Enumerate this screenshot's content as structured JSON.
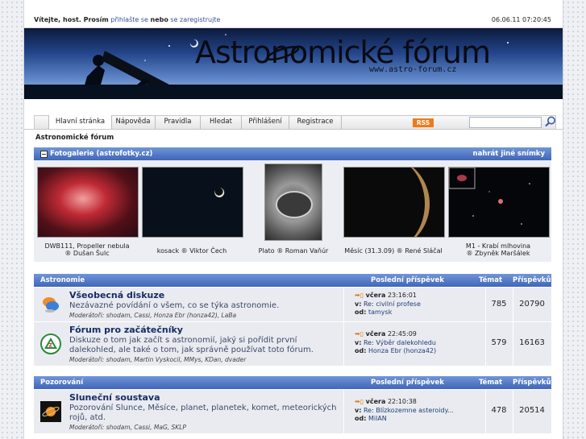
{
  "topbar": {
    "welcome": "Vítejte, host. Prosím",
    "login_link": "přihlašte se",
    "or_text": "nebo",
    "register_link": "se zaregistrujte",
    "datetime": "06.06.11 07:20:45"
  },
  "banner": {
    "title": "Astronomické fórum",
    "url": "www.astro-forum.cz"
  },
  "nav": {
    "tabs": [
      "Hlavní stránka",
      "Nápověda",
      "Pravidla",
      "Hledat",
      "Přihlášení",
      "Registrace"
    ],
    "rss": "RSS"
  },
  "breadcrumb": "Astronomické fórum",
  "gallery": {
    "title": "Fotogalerie (astrofotky.cz)",
    "action": "nahrát jiné snímky",
    "items": [
      {
        "line1": "DWB111, Propeller nebula",
        "line2": "® Dušan Šulc"
      },
      {
        "line1": "kosack ® Viktor Čech",
        "line2": ""
      },
      {
        "line1": "Plato ® Roman Vaňúr",
        "line2": ""
      },
      {
        "line1": "Měsíc (31.3.09) ® René Sláčal",
        "line2": ""
      },
      {
        "line1": "M1 - Krabí mlhovina",
        "line2": "® Zbyněk Maršálek"
      }
    ]
  },
  "categories": [
    {
      "name": "Astronomie",
      "col_last": "Poslední příspěvek",
      "col_topics": "Témat",
      "col_posts": "Příspěvků",
      "forums": [
        {
          "title": "Všeobecná diskuze",
          "desc": "Nezávazné povídání o všem, co se týka astronomie.",
          "mods": "Moderátoři: shodam, Cassi, Honza Ebr (honza42), LaBa",
          "last_when": "včera",
          "last_time": "23:16:01",
          "last_in_label": "v:",
          "last_in": "Re: civilní profese",
          "last_by_label": "od:",
          "last_by": "tamysk",
          "topics": "785",
          "posts": "20790"
        },
        {
          "title": "Fórum pro začátečníky",
          "desc": "Diskuze o tom jak začít s astronomií, jaký si pořídit první dalekohled, ale také o tom, jak správně používat toto fórum.",
          "mods": "Moderátoři: shodam, Martin Vyskocil, MMys, KDan, dvader",
          "last_when": "včera",
          "last_time": "22:45:09",
          "last_in_label": "v:",
          "last_in": "Re: Výběr dalekohledu",
          "last_by_label": "od:",
          "last_by": "Honza Ebr (honza42)",
          "topics": "579",
          "posts": "16163"
        }
      ]
    },
    {
      "name": "Pozorování",
      "col_last": "Poslední příspěvek",
      "col_topics": "Témat",
      "col_posts": "Příspěvků",
      "forums": [
        {
          "title": "Sluneční soustava",
          "desc": "Pozorování Slunce, Měsíce, planet, planetek, komet, meteorických rojů, atd.",
          "mods": "Moderátoři: shodam, Cassi, MaG, SKLP",
          "last_when": "včera",
          "last_time": "22:10:38",
          "last_in_label": "v:",
          "last_in": "Re: Blízkozemne asteroidy...",
          "last_by_label": "od:",
          "last_by": "MilAN",
          "topics": "478",
          "posts": "20514"
        }
      ]
    }
  ],
  "colors": {
    "accent": "#3f66b8",
    "row_bg": "#e9ebf0",
    "rss": "#f07a1b"
  }
}
